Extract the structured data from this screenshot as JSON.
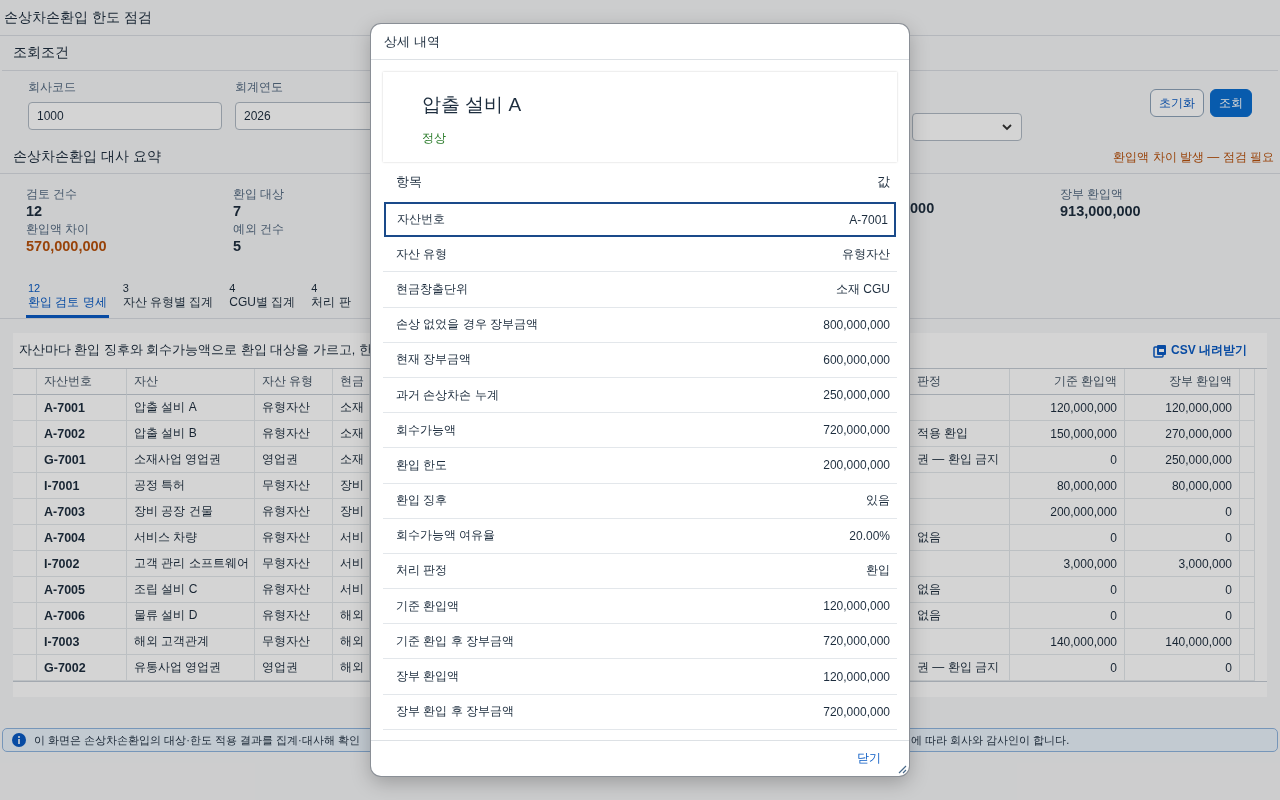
{
  "page_title": "손상차손환입 한도 점검",
  "filter": {
    "title": "조회조건",
    "fields": [
      {
        "label": "회사코드",
        "value": "1000"
      },
      {
        "label": "회계연도",
        "value": "2026"
      }
    ],
    "buttons": [
      {
        "label": "초기화",
        "kind": "secondary"
      },
      {
        "label": "조회",
        "kind": "primary"
      }
    ]
  },
  "summary": {
    "title": "손상차손환입 대사 요약",
    "alert": "환입액 차이 발생 — 점검 필요",
    "kpis": [
      {
        "label": "검토 건수",
        "value": "12",
        "warning": false
      },
      {
        "label": "환입 대상",
        "value": "7",
        "warning": false
      },
      {
        "label": "환입액 차이",
        "value": "570,000,000",
        "warning": true
      },
      {
        "label": "예외 건수",
        "value": "5",
        "warning": false
      }
    ],
    "kpis_right": [
      {
        "value": "000"
      },
      {
        "label": "장부 환입액",
        "value": "913,000,000"
      }
    ]
  },
  "tabs": [
    {
      "count": "12",
      "label": "환입 검토 명세",
      "selected": true
    },
    {
      "count": "3",
      "label": "자산 유형별 집계",
      "selected": false
    },
    {
      "count": "4",
      "label": "CGU별 집계",
      "selected": false
    },
    {
      "count": "4",
      "label": "처리 판",
      "selected": false
    }
  ],
  "table": {
    "caption": "자산마다 환입 징후와 회수가능액으로 환입 대상을 가르고, 한",
    "download": "CSV 내려받기",
    "columns_left": [
      "자산번호",
      "자산",
      "자산 유형",
      "현금"
    ],
    "columns_right": [
      "판정",
      "기준 환입액",
      "장부 환입액"
    ],
    "rows": [
      {
        "id": "A-7001",
        "asset": "압출 설비 A",
        "type": "유형자산",
        "cgu": "소재",
        "base": "120,000,000",
        "book": "120,000,000"
      },
      {
        "id": "A-7002",
        "asset": "압출 설비 B",
        "type": "유형자산",
        "cgu": "소재",
        "judgement": "적용 환입",
        "base": "150,000,000",
        "book": "270,000,000"
      },
      {
        "id": "G-7001",
        "asset": "소재사업 영업권",
        "type": "영업권",
        "cgu": "소재",
        "judgement": "권 — 환입 금지",
        "base": "0",
        "book": "250,000,000"
      },
      {
        "id": "I-7001",
        "asset": "공정 특허",
        "type": "무형자산",
        "cgu": "장비",
        "base": "80,000,000",
        "book": "80,000,000"
      },
      {
        "id": "A-7003",
        "asset": "장비 공장 건물",
        "type": "유형자산",
        "cgu": "장비",
        "base": "200,000,000",
        "book": "0"
      },
      {
        "id": "A-7004",
        "asset": "서비스 차량",
        "type": "유형자산",
        "cgu": "서비",
        "judgement": "없음",
        "base": "0",
        "book": "0"
      },
      {
        "id": "I-7002",
        "asset": "고객 관리 소프트웨어",
        "type": "무형자산",
        "cgu": "서비",
        "base": "3,000,000",
        "book": "3,000,000"
      },
      {
        "id": "A-7005",
        "asset": "조립 설비 C",
        "type": "유형자산",
        "cgu": "서비",
        "judgement": "없음",
        "base": "0",
        "book": "0"
      },
      {
        "id": "A-7006",
        "asset": "물류 설비 D",
        "type": "유형자산",
        "cgu": "해외",
        "judgement": "없음",
        "base": "0",
        "book": "0"
      },
      {
        "id": "I-7003",
        "asset": "해외 고객관계",
        "type": "무형자산",
        "cgu": "해외",
        "base": "140,000,000",
        "book": "140,000,000"
      },
      {
        "id": "G-7002",
        "asset": "유통사업 영업권",
        "type": "영업권",
        "cgu": "해외",
        "judgement": "권 — 환입 금지",
        "base": "0",
        "book": "0"
      }
    ]
  },
  "info": {
    "left": "이 화면은 손상차손환입의 대상·한도 적용 결과를 집계·대사해 확인",
    "right": "에 따라 회사와 감사인이 합니다."
  },
  "dialog": {
    "title": "상세 내역",
    "heading": "압출 설비 A",
    "status": "정상",
    "col_item": "항목",
    "col_value": "값",
    "rows": [
      {
        "label": "자산번호",
        "value": "A-7001",
        "selected": true
      },
      {
        "label": "자산 유형",
        "value": "유형자산",
        "selected": false
      },
      {
        "label": "현금창출단위",
        "value": "소재 CGU",
        "selected": false
      },
      {
        "label": "손상 없었을 경우 장부금액",
        "value": "800,000,000",
        "selected": false
      },
      {
        "label": "현재 장부금액",
        "value": "600,000,000",
        "selected": false
      },
      {
        "label": "과거 손상차손 누계",
        "value": "250,000,000",
        "selected": false
      },
      {
        "label": "회수가능액",
        "value": "720,000,000",
        "selected": false
      },
      {
        "label": "환입 한도",
        "value": "200,000,000",
        "selected": false
      },
      {
        "label": "환입 징후",
        "value": "있음",
        "selected": false
      },
      {
        "label": "회수가능액 여유율",
        "value": "20.00%",
        "selected": false
      },
      {
        "label": "처리 판정",
        "value": "환입",
        "selected": false
      },
      {
        "label": "기준 환입액",
        "value": "120,000,000",
        "selected": false
      },
      {
        "label": "기준 환입 후 장부금액",
        "value": "720,000,000",
        "selected": false
      },
      {
        "label": "장부 환입액",
        "value": "120,000,000",
        "selected": false
      },
      {
        "label": "장부 환입 후 장부금액",
        "value": "720,000,000",
        "selected": false
      }
    ],
    "close": "닫기"
  }
}
